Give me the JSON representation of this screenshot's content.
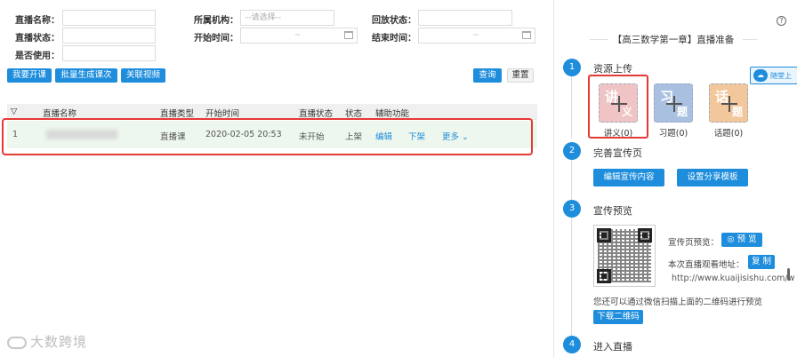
{
  "filters": {
    "name_label": "直播名称：",
    "org_label": "所属机构：",
    "org_placeholder": "--请选择--",
    "playback_label": "回放状态：",
    "live_status_label": "直播状态：",
    "start_time_label": "开始时间：",
    "end_time_label": "结束时间：",
    "enabled_label": "是否使用：",
    "range_sep": "~"
  },
  "actions": {
    "open_course": "我要开课",
    "batch_generate": "批量生成课次",
    "link_video": "关联视频",
    "query": "查询",
    "reset": "重置"
  },
  "table": {
    "columns": [
      "直播名称",
      "直播类型",
      "开始时间",
      "直播状态",
      "状态",
      "辅助功能"
    ],
    "rows": [
      {
        "index": "1",
        "type": "直播课",
        "start": "2020-02-05 20:53",
        "live_status": "未开始",
        "status": "上架",
        "edit": "编辑",
        "offline": "下架",
        "more": "更多 ⌄"
      }
    ]
  },
  "watermark": "大数跨境",
  "panel": {
    "help": "?",
    "title": "【高三数学第一章】直播准备",
    "share_label": "随堂上",
    "step1": {
      "num": "1",
      "title": "资源上传",
      "items": [
        {
          "big": "讲",
          "small": "义",
          "caption": "讲义(0)",
          "color": "#f0c4c4"
        },
        {
          "big": "习",
          "small": "题",
          "caption": "习题(0)",
          "color": "#a9c0e0"
        },
        {
          "big": "话",
          "small": "题",
          "caption": "话题(0)",
          "color": "#f2c79c"
        }
      ]
    },
    "step2": {
      "num": "2",
      "title": "完善宣传页",
      "edit_btn": "编辑宣传内容",
      "template_btn": "设置分享模板"
    },
    "step3": {
      "num": "3",
      "title": "宣传预览",
      "preview_label": "宣传页预览：",
      "preview_btn": "◎ 预 览",
      "url_label": "本次直播观看地址：",
      "copy_btn": "复 制",
      "url": "http://www.kuaijisishu.com/w",
      "hint": "您还可以通过微信扫描上面的二维码进行预览",
      "download_btn": "下载二维码"
    },
    "step4": {
      "num": "4",
      "title": "进入直播"
    }
  }
}
